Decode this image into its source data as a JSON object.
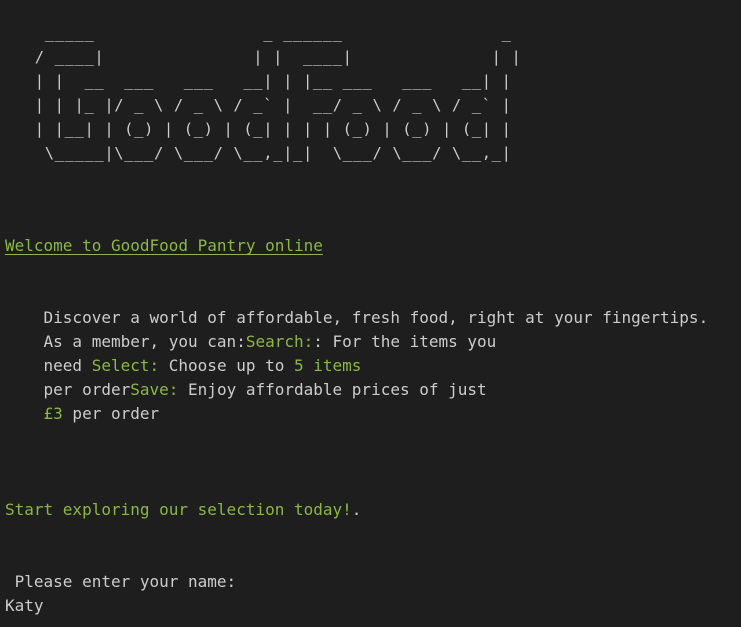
{
  "logo_ascii": "    _____                 _ ______                _\n   / ____|               | |  ____|              | |\n   | |  __  ___   ___   __| | |__ ___   ___   __| |\n   | | |_ |/ _ \\ / _ \\ / _` |  __/ _ \\ / _ \\ / _` |\n   | |__| | (_) | (_) | (_| | | | (_) | (_) | (_| |\n    \\_____|\\___/ \\___/ \\__,_|_|  \\___/ \\___/ \\__,_|",
  "welcome": "Welcome to GoodFood Pantry online",
  "intro": {
    "line1": "    Discover a world of affordable, fresh food, right at your fingertips.",
    "line2_prefix": "    As a member, you can:",
    "line2_search": "Search:",
    "line2_suffix": ": For the items you",
    "line3_prefix": "    need ",
    "line3_select": "Select:",
    "line3_mid": " Choose up to ",
    "line3_count": "5 items",
    "line4_prefix": "    per order",
    "line4_save": "Save:",
    "line4_suffix": " Enjoy affordable prices of just",
    "line5_prefix": "    ",
    "line5_price": "£3",
    "line5_suffix": " per order"
  },
  "cta": "Start exploring our selection today!",
  "cta_end": ".",
  "prompt": " Please enter your name:",
  "input_value": "Katy",
  "colors": {
    "background": "#1e1e1e",
    "text": "#cccccc",
    "accent_green": "#8ab846"
  }
}
